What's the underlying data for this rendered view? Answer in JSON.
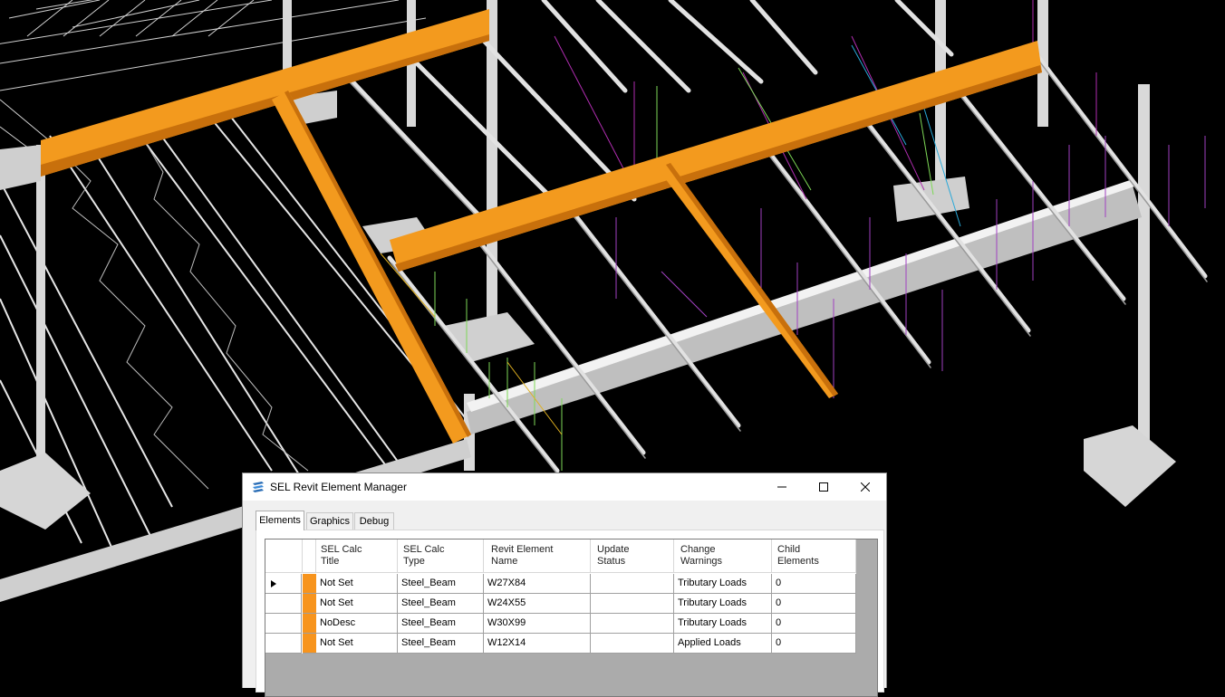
{
  "colors": {
    "beam_highlight": "#f39a1e",
    "beam_shadow": "#c8700c",
    "steel": "#d9d9d9",
    "footing": "#d6d6d6",
    "row_marker": "#f7941d",
    "grid_background": "#ababab"
  },
  "window": {
    "title": "SEL Revit Element Manager",
    "icon": "sel-app-icon",
    "controls": {
      "minimize": "minimize-icon",
      "maximize": "maximize-icon",
      "close": "close-icon"
    }
  },
  "tabs": [
    {
      "label": "Elements",
      "active": true
    },
    {
      "label": "Graphics",
      "active": false
    },
    {
      "label": "Debug",
      "active": false
    }
  ],
  "grid": {
    "columns": [
      {
        "line1": "SEL Calc",
        "line2": "Title"
      },
      {
        "line1": "SEL Calc",
        "line2": "Type"
      },
      {
        "line1": "Revit Element",
        "line2": "Name"
      },
      {
        "line1": "Update",
        "line2": "Status"
      },
      {
        "line1": "Change",
        "line2": "Warnings"
      },
      {
        "line1": "Child",
        "line2": "Elements"
      }
    ],
    "rows": [
      {
        "selected": true,
        "cells": [
          "Not Set",
          "Steel_Beam",
          "W27X84",
          "",
          "Tributary Loads",
          "0"
        ]
      },
      {
        "selected": false,
        "cells": [
          "Not Set",
          "Steel_Beam",
          "W24X55",
          "",
          "Tributary Loads",
          "0"
        ]
      },
      {
        "selected": false,
        "cells": [
          "NoDesc",
          "Steel_Beam",
          "W30X99",
          "",
          "Tributary Loads",
          "0"
        ]
      },
      {
        "selected": false,
        "cells": [
          "Not Set",
          "Steel_Beam",
          "W12X14",
          "",
          "Applied Loads",
          "0"
        ]
      }
    ],
    "current_row_icon": "row-pointer-icon"
  }
}
